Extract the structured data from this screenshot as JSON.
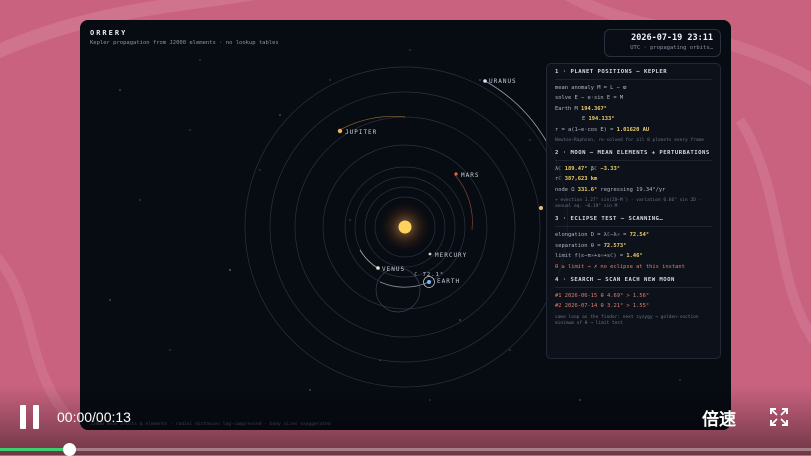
{
  "brand": {
    "title": "ORRERY",
    "subtitle": "Kepler propagation from J2000 elements · no lookup tables"
  },
  "clock": {
    "time": "2026-07-19 23:11",
    "status": "UTC · propagating orbits…"
  },
  "planet_labels": {
    "uranus": "URANUS",
    "jupiter": "JUPITER",
    "mars": "MARS",
    "mercury": "MERCURY",
    "venus": "VENUS",
    "earth": "EARTH",
    "moon": "☾ 72.1°"
  },
  "panel": {
    "s1": {
      "heading": "1 · PLANET POSITIONS — KEPLER",
      "mean": "mean anomaly  M = L − ϖ",
      "solve": "solve  E − e·sin E = M",
      "earth_m_label": "Earth  M",
      "earth_m_value": "194.367°",
      "e_label": "E",
      "e_value": "194.133°",
      "r_label": "r = a(1−e·cos E) =",
      "r_value": "1.01620 AU",
      "note": "Newton–Raphson, re-solved for all 8 planets every frame"
    },
    "s2": {
      "heading": "2 · MOON — MEAN ELEMENTS + PERTURBATIONS",
      "lambda_label": "λ☾",
      "lambda_value": "189.47°",
      "beta_label": "β☾",
      "beta_value": "−3.33°",
      "r_label": "r☾",
      "r_value": "387,623 km",
      "node_label": "node Ω",
      "node_value": "331.6°",
      "node_note": "regressing 19.34°/yr",
      "note": "+ evection 1.27° sin(2D−M′) · variation 0.66° sin 2D · annual eq. −0.19° sin M"
    },
    "s3": {
      "heading": "3 · ECLIPSE TEST — SCANNING…",
      "elong_label": "elongation  D = λ☾−λ☉ =",
      "elong_value": "72.54°",
      "sep_label": "separation  θ =",
      "sep_value": "72.573°",
      "limit_label": "limit  f(ε−π☉+s☉+s☾) =",
      "limit_value": "1.46°",
      "verdict": "θ ≥ limit  →  ✗ no eclipse at this instant"
    },
    "s4": {
      "heading": "4 · SEARCH — SCAN EACH NEW MOON",
      "rows": [
        {
          "idx": "#1",
          "date": "2026-06-15",
          "theta": "θ 4.69°",
          "cmp": "> 1.56°"
        },
        {
          "idx": "#2",
          "date": "2026-07-14",
          "theta": "θ 3.21°",
          "cmp": "> 1.55°"
        }
      ],
      "note": "same loop as the finder: next syzygy → golden-section minimum of θ → limit test"
    }
  },
  "caption": "J2000 mean orbits & elements · radial distances log-compressed · body sizes exaggerated",
  "player": {
    "timecode": "00:00/00:13",
    "speed_label": "倍速",
    "progress": 0.085
  },
  "colors": {
    "background": "#c9627f",
    "progress_fill": "#3ccf6e",
    "highlight": "#f1d06a",
    "warning": "#e07d6a"
  },
  "icons": {
    "pause": "pause-icon",
    "fullscreen": "fullscreen-icon"
  }
}
